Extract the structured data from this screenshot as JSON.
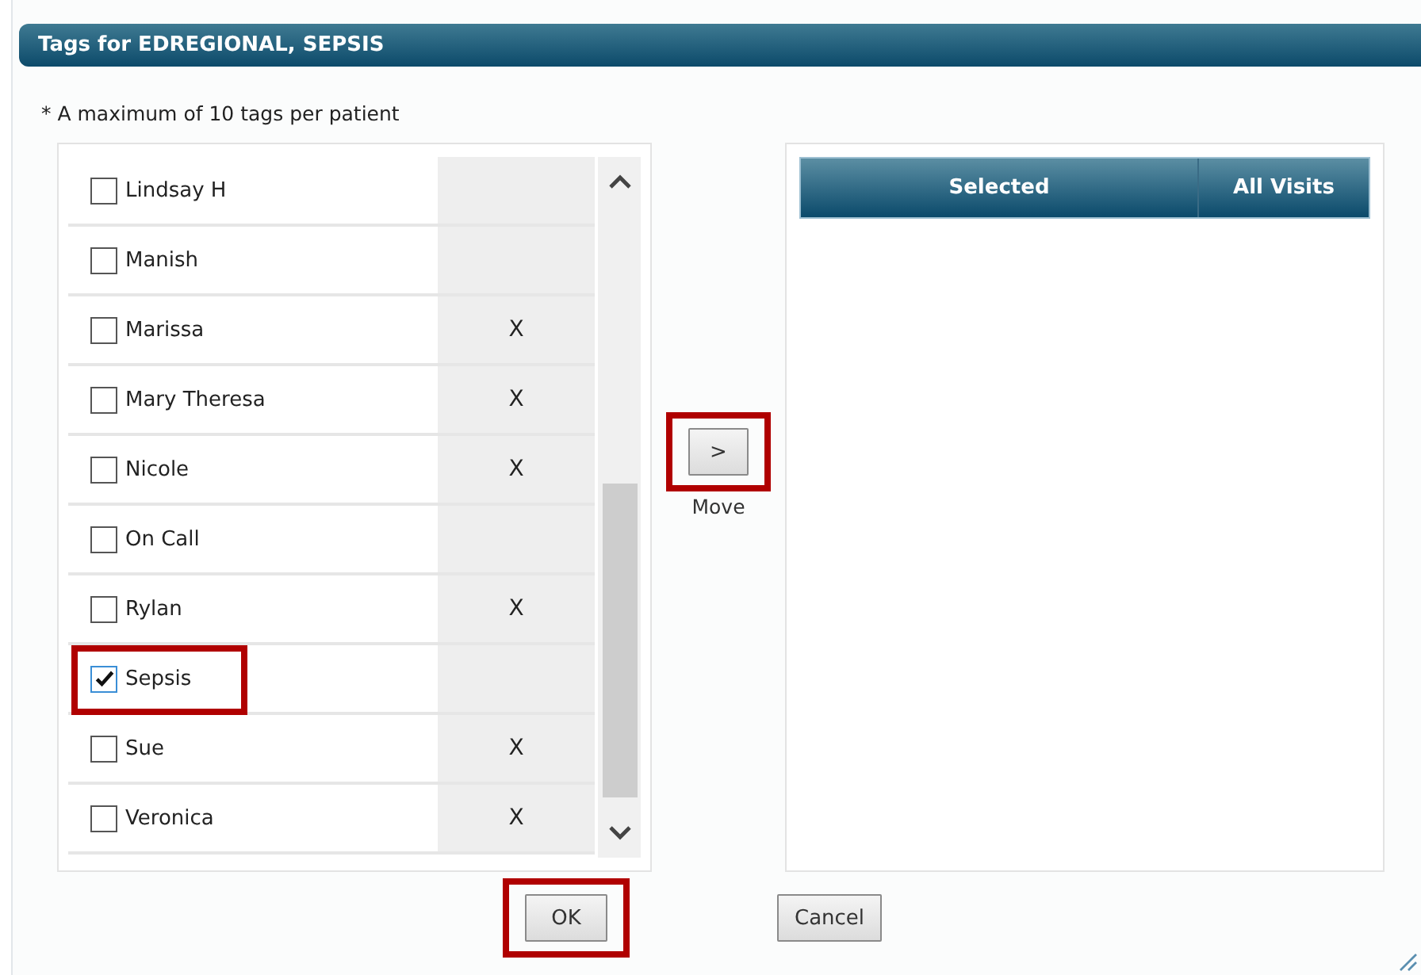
{
  "dialog": {
    "title": "Tags for EDREGIONAL, SEPSIS"
  },
  "note": "* A maximum of 10 tags per patient",
  "tags": [
    {
      "name": "Lindsay H",
      "checked": false,
      "highlighted": false
    },
    {
      "name": "Manish",
      "checked": false,
      "highlighted": false
    },
    {
      "name": "Marissa",
      "checked": false,
      "mark": "X",
      "highlighted": false
    },
    {
      "name": "Mary Theresa",
      "checked": false,
      "mark": "X",
      "highlighted": false
    },
    {
      "name": "Nicole",
      "checked": false,
      "mark": "X",
      "highlighted": false
    },
    {
      "name": "On Call",
      "checked": false,
      "highlighted": false
    },
    {
      "name": "Rylan",
      "checked": false,
      "mark": "X",
      "highlighted": false
    },
    {
      "name": "Sepsis",
      "checked": true,
      "highlighted": true
    },
    {
      "name": "Sue",
      "checked": false,
      "mark": "X",
      "highlighted": false
    },
    {
      "name": "Veronica",
      "checked": false,
      "mark": "X",
      "highlighted": false
    }
  ],
  "move": {
    "button": ">",
    "label": "Move",
    "highlighted": true
  },
  "selected_table": {
    "columns": [
      "Selected",
      "All Visits"
    ]
  },
  "buttons": [
    {
      "label": "OK",
      "highlighted": true
    },
    {
      "label": "Cancel",
      "highlighted": false
    }
  ]
}
